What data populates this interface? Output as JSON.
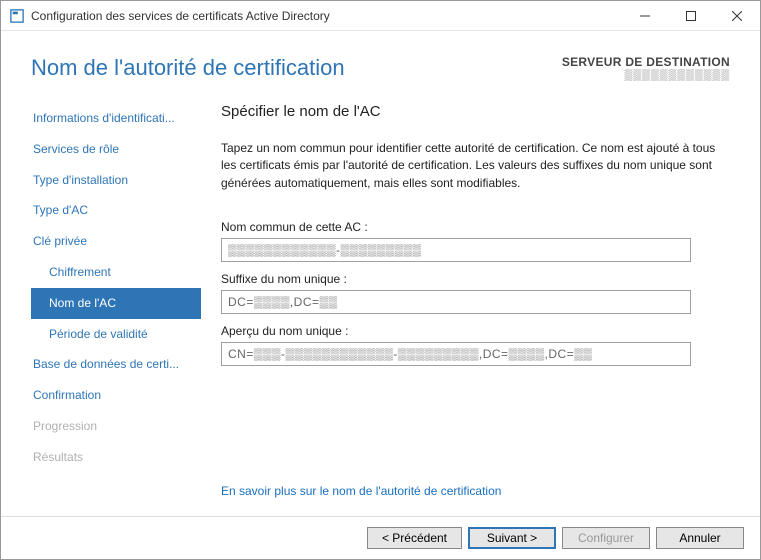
{
  "titlebar": {
    "title": "Configuration des services de certificats Active Directory"
  },
  "header": {
    "page_title": "Nom de l'autorité de certification",
    "dest_label": "SERVEUR DE DESTINATION",
    "dest_value": "▒▒▒▒▒▒▒▒▒▒▒▒"
  },
  "sidebar": {
    "items": [
      {
        "label": "Informations d'identificati...",
        "sub": false,
        "selected": false,
        "disabled": false
      },
      {
        "label": "Services de rôle",
        "sub": false,
        "selected": false,
        "disabled": false
      },
      {
        "label": "Type d'installation",
        "sub": false,
        "selected": false,
        "disabled": false
      },
      {
        "label": "Type d'AC",
        "sub": false,
        "selected": false,
        "disabled": false
      },
      {
        "label": "Clé privée",
        "sub": false,
        "selected": false,
        "disabled": false
      },
      {
        "label": "Chiffrement",
        "sub": true,
        "selected": false,
        "disabled": false
      },
      {
        "label": "Nom de l'AC",
        "sub": true,
        "selected": true,
        "disabled": false
      },
      {
        "label": "Période de validité",
        "sub": true,
        "selected": false,
        "disabled": false
      },
      {
        "label": "Base de données de certi...",
        "sub": false,
        "selected": false,
        "disabled": false
      },
      {
        "label": "Confirmation",
        "sub": false,
        "selected": false,
        "disabled": false
      },
      {
        "label": "Progression",
        "sub": false,
        "selected": false,
        "disabled": true
      },
      {
        "label": "Résultats",
        "sub": false,
        "selected": false,
        "disabled": true
      }
    ]
  },
  "content": {
    "heading": "Spécifier le nom de l'AC",
    "description": "Tapez un nom commun pour identifier cette autorité de certification. Ce nom est ajouté à tous les certificats émis par l'autorité de certification. Les valeurs des suffixes du nom unique sont générées automatiquement, mais elles sont modifiables.",
    "fields": {
      "common_name": {
        "label": "Nom commun de cette AC :",
        "value": "▒▒▒▒▒▒▒▒▒▒▒▒-▒▒▒▒▒▒▒▒▒"
      },
      "dn_suffix": {
        "label": "Suffixe du nom unique :",
        "value": "DC=▒▒▒▒,DC=▒▒"
      },
      "dn_preview": {
        "label": "Aperçu du nom unique :",
        "value": "CN=▒▒▒-▒▒▒▒▒▒▒▒▒▒▒▒-▒▒▒▒▒▒▒▒▒,DC=▒▒▒▒,DC=▒▒"
      }
    },
    "help_link": "En savoir plus sur le nom de l'autorité de certification"
  },
  "buttons": {
    "previous": "< Précédent",
    "next": "Suivant >",
    "configure": "Configurer",
    "cancel": "Annuler"
  }
}
